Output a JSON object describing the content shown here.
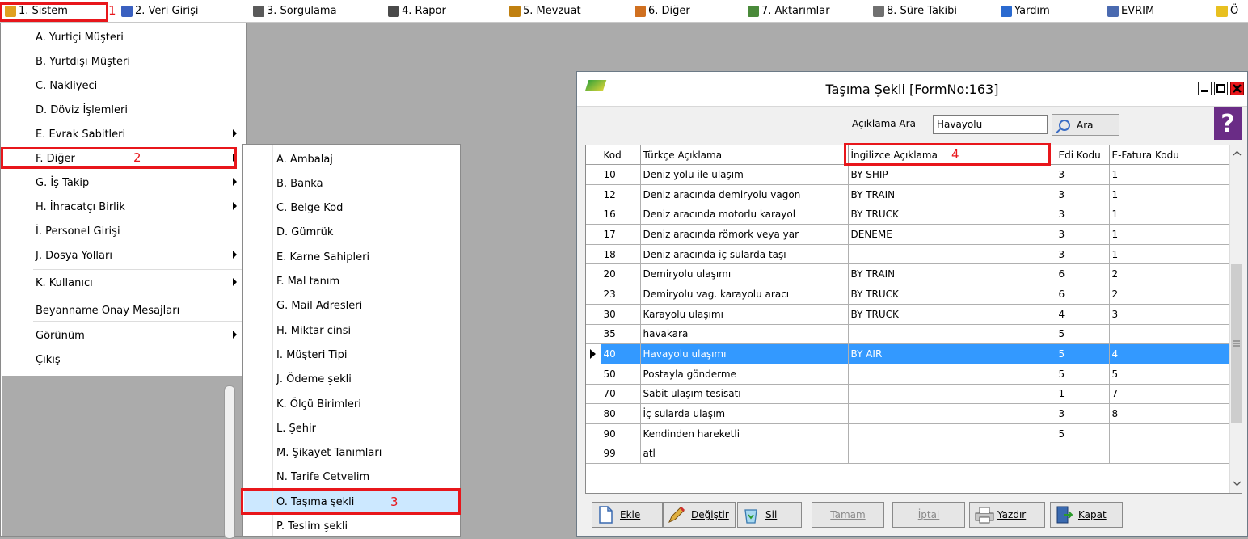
{
  "menubar": {
    "items": [
      {
        "label": "1. Sistem",
        "icon": "wizard-icon",
        "color": "#e0a020"
      },
      {
        "label": "2. Veri Girişi",
        "icon": "edit-icon",
        "color": "#3a60c0"
      },
      {
        "label": "3. Sorgulama",
        "icon": "query-icon",
        "color": "#5a5a5a"
      },
      {
        "label": "4. Rapor",
        "icon": "printer-icon",
        "color": "#4a4a4a"
      },
      {
        "label": "5. Mevzuat",
        "icon": "books-icon",
        "color": "#c08010"
      },
      {
        "label": "6. Diğer",
        "icon": "tools-icon",
        "color": "#d07020"
      },
      {
        "label": "7. Aktarımlar",
        "icon": "gears-icon",
        "color": "#4a8a3a"
      },
      {
        "label": "8. Süre Takibi",
        "icon": "calendar-icon",
        "color": "#707070"
      },
      {
        "label": "Yardım",
        "icon": "help-circle-icon",
        "color": "#2a6ad0"
      },
      {
        "label": "EVRIM",
        "icon": "gem-icon",
        "color": "#4a6ab0"
      },
      {
        "label": "Ö",
        "icon": "star-icon",
        "color": "#e8c020"
      }
    ]
  },
  "menu_sistem": {
    "items": [
      {
        "label": "A.  Yurtiçi Müşteri",
        "submenu": false
      },
      {
        "label": "B.  Yurtdışı Müşteri",
        "submenu": false
      },
      {
        "label": "C.  Nakliyeci",
        "submenu": false
      },
      {
        "label": "D.  Döviz İşlemleri",
        "submenu": false
      },
      {
        "label": "E.  Evrak Sabitleri",
        "submenu": true
      },
      {
        "label": "F.  Diğer",
        "submenu": true
      },
      {
        "label": "G.  İş Takip",
        "submenu": true
      },
      {
        "label": "H.  İhracatçı Birlik",
        "submenu": true
      },
      {
        "label": "İ.   Personel Girişi",
        "submenu": false
      },
      {
        "label": "J.  Dosya Yolları",
        "submenu": true
      },
      {
        "label": "K.  Kullanıcı",
        "submenu": true
      },
      {
        "label": "Beyanname Onay Mesajları",
        "submenu": false
      },
      {
        "label": "Görünüm",
        "submenu": true
      },
      {
        "label": "Çıkış",
        "submenu": false
      }
    ]
  },
  "menu_diger": {
    "items": [
      "A.  Ambalaj",
      "B.  Banka",
      "C.  Belge Kod",
      "D.  Gümrük",
      "E.  Karne Sahipleri",
      "F.  Mal tanım",
      "G.  Mail Adresleri",
      "H.  Miktar cinsi",
      "I.  Müşteri Tipi",
      "J.  Ödeme şekli",
      "K.  Ölçü Birimleri",
      "L.  Şehir",
      "M.  Şikayet Tanımları",
      "N.  Tarife Cetvelim",
      "O.  Taşıma şekli",
      "P.  Teslim şekli"
    ]
  },
  "annotations": {
    "step1": "1",
    "step2": "2",
    "step3": "3",
    "step4": "4",
    "color": "#e8161b"
  },
  "window": {
    "title": "Taşıma Şekli [FormNo:163]",
    "search_label": "Açıklama Ara",
    "search_value": "Havayolu",
    "search_button": "Ara",
    "help_label": "?",
    "columns": [
      "Kod",
      "Türkçe Açıklama",
      "İngilizce Açıklama",
      "Edi Kodu",
      "E-Fatura Kodu"
    ],
    "rows": [
      {
        "kod": "10",
        "tr": "Deniz yolu ile ulaşım",
        "en": "BY SHIP",
        "edi": "3",
        "efatura": "1"
      },
      {
        "kod": "12",
        "tr": "Deniz aracında demiryolu vagon",
        "en": "BY TRAIN",
        "edi": "3",
        "efatura": "1"
      },
      {
        "kod": "16",
        "tr": "Deniz aracında motorlu karayol",
        "en": "BY TRUCK",
        "edi": "3",
        "efatura": "1"
      },
      {
        "kod": "17",
        "tr": "Deniz aracında römork veya yar",
        "en": "DENEME",
        "edi": "3",
        "efatura": "1"
      },
      {
        "kod": "18",
        "tr": "Deniz aracında iç sularda taşı",
        "en": "",
        "edi": "3",
        "efatura": "1"
      },
      {
        "kod": "20",
        "tr": "Demiryolu ulaşımı",
        "en": "BY TRAIN",
        "edi": "6",
        "efatura": "2"
      },
      {
        "kod": "23",
        "tr": "Demiryolu vag. karayolu aracı",
        "en": "BY TRUCK",
        "edi": "6",
        "efatura": "2"
      },
      {
        "kod": "30",
        "tr": "Karayolu ulaşımı",
        "en": "BY TRUCK",
        "edi": "4",
        "efatura": "3"
      },
      {
        "kod": "35",
        "tr": "havakara",
        "en": "",
        "edi": "5",
        "efatura": ""
      },
      {
        "kod": "40",
        "tr": "Havayolu ulaşımı",
        "en": "BY AIR",
        "edi": "5",
        "efatura": "4"
      },
      {
        "kod": "50",
        "tr": "Postayla gönderme",
        "en": "",
        "edi": "5",
        "efatura": "5"
      },
      {
        "kod": "70",
        "tr": "Sabit ulaşım tesisatı",
        "en": "",
        "edi": "1",
        "efatura": "7"
      },
      {
        "kod": "80",
        "tr": "İç sularda ulaşım",
        "en": "",
        "edi": "3",
        "efatura": "8"
      },
      {
        "kod": "90",
        "tr": "Kendinden hareketli",
        "en": "",
        "edi": "5",
        "efatura": ""
      },
      {
        "kod": "99",
        "tr": "atl",
        "en": "",
        "edi": "",
        "efatura": ""
      }
    ],
    "buttons": {
      "ekle": "Ekle",
      "degistir": "Değiştir",
      "sil": "Sil",
      "tamam": "Tamam",
      "iptal": "İptal",
      "yazdir": "Yazdır",
      "kapat": "Kapat"
    }
  },
  "colors": {
    "selection": "#3399ff",
    "menu_highlight": "#cce8ff",
    "desktop": "#ababab"
  }
}
